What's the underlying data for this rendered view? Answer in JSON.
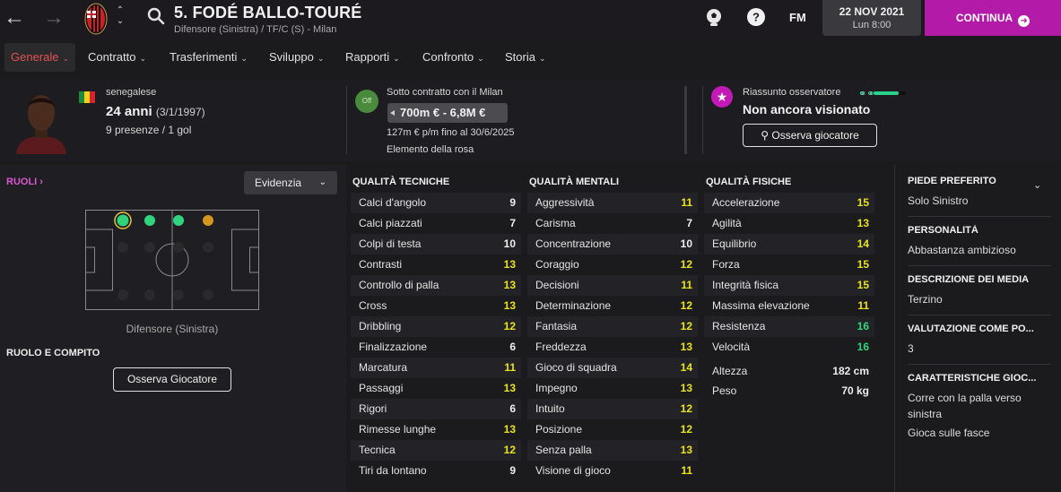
{
  "header": {
    "back_icon": "back-arrow",
    "forward_icon": "forward-arrow",
    "club_crest": "ac-milan-crest",
    "player_name": "5. FODÉ BALLO-TOURÉ",
    "player_subtitle": "Difensore (Sinistra) / TF/C (S) - Milan",
    "icons": [
      "ball-icon",
      "help-icon"
    ],
    "fm_label": "FM",
    "date": "22 NOV 2021",
    "time": "Lun 8:00",
    "continue_label": "CONTINUA",
    "accent_color": "#b31aa7"
  },
  "tabs": [
    {
      "label": "Generale",
      "active": true
    },
    {
      "label": "Contratto"
    },
    {
      "label": "Trasferimenti"
    },
    {
      "label": "Sviluppo"
    },
    {
      "label": "Rapporti"
    },
    {
      "label": "Confronto"
    },
    {
      "label": "Storia"
    }
  ],
  "info": {
    "nationality": "senegalese",
    "age": "24 anni",
    "dob": "(3/1/1997)",
    "appearances": "9 presenze / 1 gol",
    "contract_badge": "Off",
    "contract_title": "Sotto contratto con il Milan",
    "value": "700m € - 6,8M €",
    "wage": "127m € p/m fino al 30/6/2025",
    "squad_status": "Elemento della rosa",
    "scout_title": "Riassunto osservatore",
    "scout_progress": 0.78,
    "scout_status": "Non ancora visionato",
    "scout_button": "Osserva giocatore"
  },
  "roles": {
    "title": "RUOLI",
    "highlight_label": "Evidenzia",
    "position_label": "Difensore (Sinistra)",
    "role_title": "RUOLO E COMPITO",
    "role_button": "Osserva Giocatore"
  },
  "technical": {
    "title": "QUALITÀ TECNICHE",
    "rows": [
      {
        "name": "Calci d'angolo",
        "value": "9"
      },
      {
        "name": "Calci piazzati",
        "value": "7"
      },
      {
        "name": "Colpi di testa",
        "value": "10"
      },
      {
        "name": "Contrasti",
        "value": "13"
      },
      {
        "name": "Controllo di palla",
        "value": "13"
      },
      {
        "name": "Cross",
        "value": "13"
      },
      {
        "name": "Dribbling",
        "value": "12"
      },
      {
        "name": "Finalizzazione",
        "value": "6"
      },
      {
        "name": "Marcatura",
        "value": "11"
      },
      {
        "name": "Passaggi",
        "value": "13"
      },
      {
        "name": "Rigori",
        "value": "6"
      },
      {
        "name": "Rimesse lunghe",
        "value": "13"
      },
      {
        "name": "Tecnica",
        "value": "12"
      },
      {
        "name": "Tiri da lontano",
        "value": "9"
      }
    ]
  },
  "mental": {
    "title": "QUALITÀ MENTALI",
    "rows": [
      {
        "name": "Aggressività",
        "value": "11"
      },
      {
        "name": "Carisma",
        "value": "7"
      },
      {
        "name": "Concentrazione",
        "value": "10"
      },
      {
        "name": "Coraggio",
        "value": "12"
      },
      {
        "name": "Decisioni",
        "value": "11"
      },
      {
        "name": "Determinazione",
        "value": "12"
      },
      {
        "name": "Fantasia",
        "value": "12"
      },
      {
        "name": "Freddezza",
        "value": "13"
      },
      {
        "name": "Gioco di squadra",
        "value": "14"
      },
      {
        "name": "Impegno",
        "value": "13"
      },
      {
        "name": "Intuito",
        "value": "12"
      },
      {
        "name": "Posizione",
        "value": "12"
      },
      {
        "name": "Senza palla",
        "value": "13"
      },
      {
        "name": "Visione di gioco",
        "value": "11"
      }
    ]
  },
  "physical": {
    "title": "QUALITÀ FISICHE",
    "rows": [
      {
        "name": "Accelerazione",
        "value": "15"
      },
      {
        "name": "Agilità",
        "value": "13"
      },
      {
        "name": "Equilibrio",
        "value": "14"
      },
      {
        "name": "Forza",
        "value": "15"
      },
      {
        "name": "Integrità fisica",
        "value": "15"
      },
      {
        "name": "Massima elevazione",
        "value": "11"
      },
      {
        "name": "Resistenza",
        "value": "16"
      },
      {
        "name": "Velocità",
        "value": "16"
      }
    ],
    "height_label": "Altezza",
    "height": "182 cm",
    "weight_label": "Peso",
    "weight": "70 kg"
  },
  "sidebar": {
    "foot_title": "PIEDE PREFERITO",
    "foot": "Solo Sinistro",
    "personality_title": "PERSONALITÀ",
    "personality": "Abbastanza ambizioso",
    "media_title": "DESCRIZIONE DEI MEDIA",
    "media": "Terzino",
    "rating_title": "VALUTAZIONE COME PO...",
    "rating": "3",
    "traits_title": "CARATTERISTICHE GIOC...",
    "traits": [
      "Corre con la palla verso sinistra",
      "Gioca sulle fasce"
    ]
  },
  "colors": {
    "value_yellow": "#e9e41c",
    "value_green": "#2fd47c",
    "value_white": "#ededed",
    "tab_active": "#e35151"
  }
}
